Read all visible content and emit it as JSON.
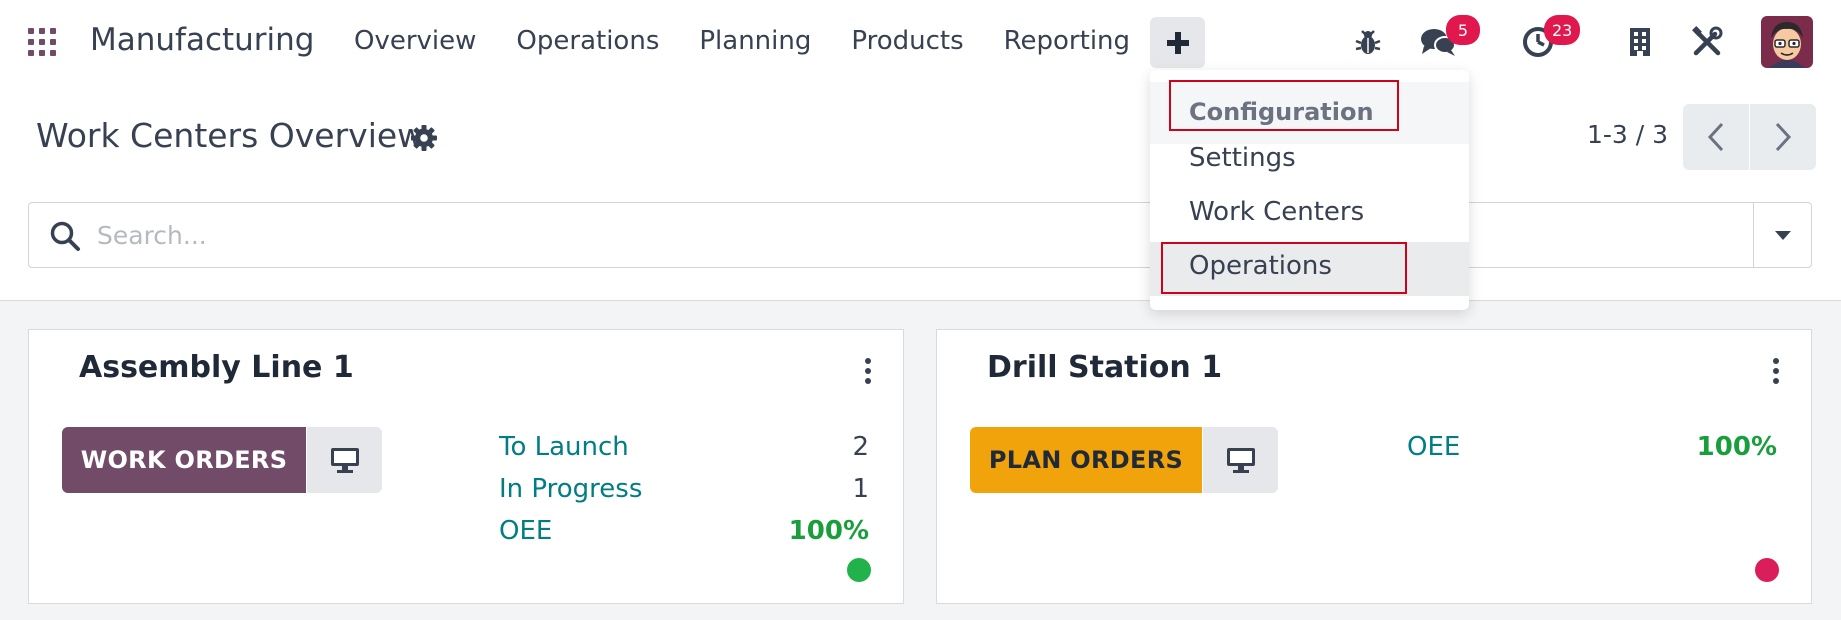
{
  "app": {
    "brand": "Manufacturing"
  },
  "nav": {
    "items": [
      "Overview",
      "Operations",
      "Planning",
      "Products",
      "Reporting"
    ],
    "plus_label": "+"
  },
  "systray": {
    "messages_badge": "5",
    "activities_badge": "23"
  },
  "page": {
    "title": "Work Centers Overview",
    "pager": "1-3 / 3"
  },
  "search": {
    "placeholder": "Search..."
  },
  "dropdown": {
    "header": "Configuration",
    "items": [
      "Settings",
      "Work Centers",
      "Operations"
    ]
  },
  "cards": [
    {
      "title": "Assembly Line 1",
      "button": "WORK ORDERS",
      "stats": [
        {
          "label": "To Launch",
          "value": "2"
        },
        {
          "label": "In Progress",
          "value": "1"
        },
        {
          "label": "OEE",
          "value": "100%"
        }
      ],
      "status_color": "#21b24b"
    },
    {
      "title": "Drill Station 1",
      "button": "PLAN ORDERS",
      "stats": [
        {
          "label": "OEE",
          "value": "100%"
        }
      ],
      "status_color": "#d91e5b"
    }
  ],
  "colors": {
    "brand": "#714B67",
    "link": "#017e84",
    "success": "#1a9e3c",
    "warning": "#f0a30a",
    "badge": "#e0184d",
    "highlight_box": "#d0021b"
  }
}
